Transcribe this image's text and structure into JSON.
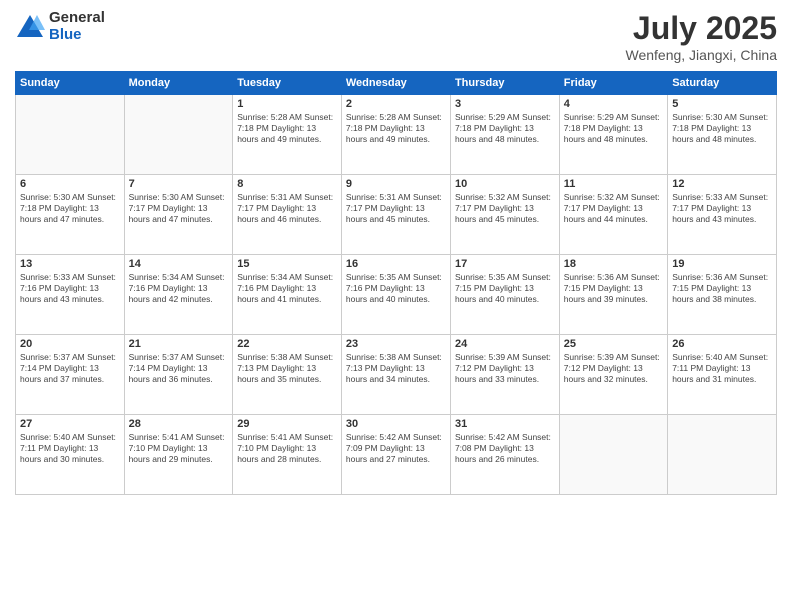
{
  "logo": {
    "general": "General",
    "blue": "Blue"
  },
  "header": {
    "month": "July 2025",
    "location": "Wenfeng, Jiangxi, China"
  },
  "weekdays": [
    "Sunday",
    "Monday",
    "Tuesday",
    "Wednesday",
    "Thursday",
    "Friday",
    "Saturday"
  ],
  "weeks": [
    [
      {
        "day": "",
        "info": ""
      },
      {
        "day": "",
        "info": ""
      },
      {
        "day": "1",
        "info": "Sunrise: 5:28 AM\nSunset: 7:18 PM\nDaylight: 13 hours and 49 minutes."
      },
      {
        "day": "2",
        "info": "Sunrise: 5:28 AM\nSunset: 7:18 PM\nDaylight: 13 hours and 49 minutes."
      },
      {
        "day": "3",
        "info": "Sunrise: 5:29 AM\nSunset: 7:18 PM\nDaylight: 13 hours and 48 minutes."
      },
      {
        "day": "4",
        "info": "Sunrise: 5:29 AM\nSunset: 7:18 PM\nDaylight: 13 hours and 48 minutes."
      },
      {
        "day": "5",
        "info": "Sunrise: 5:30 AM\nSunset: 7:18 PM\nDaylight: 13 hours and 48 minutes."
      }
    ],
    [
      {
        "day": "6",
        "info": "Sunrise: 5:30 AM\nSunset: 7:18 PM\nDaylight: 13 hours and 47 minutes."
      },
      {
        "day": "7",
        "info": "Sunrise: 5:30 AM\nSunset: 7:17 PM\nDaylight: 13 hours and 47 minutes."
      },
      {
        "day": "8",
        "info": "Sunrise: 5:31 AM\nSunset: 7:17 PM\nDaylight: 13 hours and 46 minutes."
      },
      {
        "day": "9",
        "info": "Sunrise: 5:31 AM\nSunset: 7:17 PM\nDaylight: 13 hours and 45 minutes."
      },
      {
        "day": "10",
        "info": "Sunrise: 5:32 AM\nSunset: 7:17 PM\nDaylight: 13 hours and 45 minutes."
      },
      {
        "day": "11",
        "info": "Sunrise: 5:32 AM\nSunset: 7:17 PM\nDaylight: 13 hours and 44 minutes."
      },
      {
        "day": "12",
        "info": "Sunrise: 5:33 AM\nSunset: 7:17 PM\nDaylight: 13 hours and 43 minutes."
      }
    ],
    [
      {
        "day": "13",
        "info": "Sunrise: 5:33 AM\nSunset: 7:16 PM\nDaylight: 13 hours and 43 minutes."
      },
      {
        "day": "14",
        "info": "Sunrise: 5:34 AM\nSunset: 7:16 PM\nDaylight: 13 hours and 42 minutes."
      },
      {
        "day": "15",
        "info": "Sunrise: 5:34 AM\nSunset: 7:16 PM\nDaylight: 13 hours and 41 minutes."
      },
      {
        "day": "16",
        "info": "Sunrise: 5:35 AM\nSunset: 7:16 PM\nDaylight: 13 hours and 40 minutes."
      },
      {
        "day": "17",
        "info": "Sunrise: 5:35 AM\nSunset: 7:15 PM\nDaylight: 13 hours and 40 minutes."
      },
      {
        "day": "18",
        "info": "Sunrise: 5:36 AM\nSunset: 7:15 PM\nDaylight: 13 hours and 39 minutes."
      },
      {
        "day": "19",
        "info": "Sunrise: 5:36 AM\nSunset: 7:15 PM\nDaylight: 13 hours and 38 minutes."
      }
    ],
    [
      {
        "day": "20",
        "info": "Sunrise: 5:37 AM\nSunset: 7:14 PM\nDaylight: 13 hours and 37 minutes."
      },
      {
        "day": "21",
        "info": "Sunrise: 5:37 AM\nSunset: 7:14 PM\nDaylight: 13 hours and 36 minutes."
      },
      {
        "day": "22",
        "info": "Sunrise: 5:38 AM\nSunset: 7:13 PM\nDaylight: 13 hours and 35 minutes."
      },
      {
        "day": "23",
        "info": "Sunrise: 5:38 AM\nSunset: 7:13 PM\nDaylight: 13 hours and 34 minutes."
      },
      {
        "day": "24",
        "info": "Sunrise: 5:39 AM\nSunset: 7:12 PM\nDaylight: 13 hours and 33 minutes."
      },
      {
        "day": "25",
        "info": "Sunrise: 5:39 AM\nSunset: 7:12 PM\nDaylight: 13 hours and 32 minutes."
      },
      {
        "day": "26",
        "info": "Sunrise: 5:40 AM\nSunset: 7:11 PM\nDaylight: 13 hours and 31 minutes."
      }
    ],
    [
      {
        "day": "27",
        "info": "Sunrise: 5:40 AM\nSunset: 7:11 PM\nDaylight: 13 hours and 30 minutes."
      },
      {
        "day": "28",
        "info": "Sunrise: 5:41 AM\nSunset: 7:10 PM\nDaylight: 13 hours and 29 minutes."
      },
      {
        "day": "29",
        "info": "Sunrise: 5:41 AM\nSunset: 7:10 PM\nDaylight: 13 hours and 28 minutes."
      },
      {
        "day": "30",
        "info": "Sunrise: 5:42 AM\nSunset: 7:09 PM\nDaylight: 13 hours and 27 minutes."
      },
      {
        "day": "31",
        "info": "Sunrise: 5:42 AM\nSunset: 7:08 PM\nDaylight: 13 hours and 26 minutes."
      },
      {
        "day": "",
        "info": ""
      },
      {
        "day": "",
        "info": ""
      }
    ]
  ]
}
